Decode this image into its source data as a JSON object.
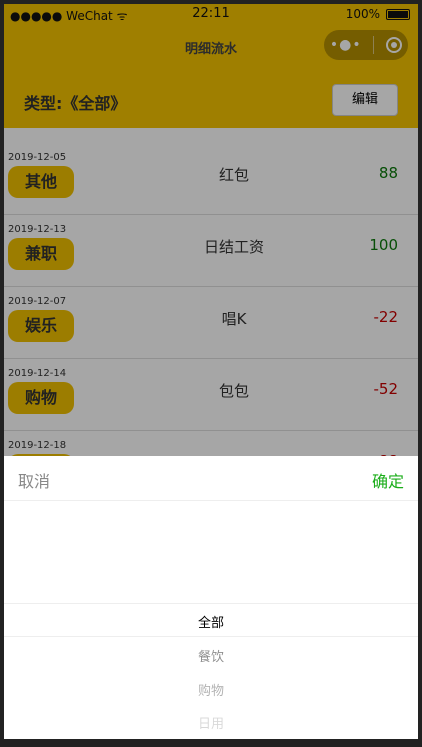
{
  "statusbar": {
    "carrier": "●●●●● WeChat",
    "wifi": "ᯤ",
    "time": "22:11",
    "battery": "100%"
  },
  "navbar": {
    "title": "明细流水",
    "more": "•●•"
  },
  "typebar": {
    "label": "类型:《全部》",
    "edit": "编辑"
  },
  "rows": [
    {
      "date": "2019-12-05",
      "tag": "其他",
      "name": "红包",
      "amount": "88",
      "sign": "pos"
    },
    {
      "date": "2019-12-13",
      "tag": "兼职",
      "name": "日结工资",
      "amount": "100",
      "sign": "pos"
    },
    {
      "date": "2019-12-07",
      "tag": "娱乐",
      "name": "唱K",
      "amount": "-22",
      "sign": "neg"
    },
    {
      "date": "2019-12-14",
      "tag": "购物",
      "name": "包包",
      "amount": "-52",
      "sign": "neg"
    },
    {
      "date": "2019-12-18",
      "tag": "",
      "name": "",
      "amount": "-88",
      "sign": "neg"
    }
  ],
  "sheet": {
    "cancel": "取消",
    "confirm": "确定"
  },
  "picker": {
    "options": [
      {
        "label": "全部",
        "opacity": 1.0
      },
      {
        "label": "餐饮",
        "opacity": 0.45
      },
      {
        "label": "购物",
        "opacity": 0.3
      },
      {
        "label": "日用",
        "opacity": 0.15
      }
    ]
  },
  "colors": {
    "primary": "#f4c300",
    "positive": "#0b7a0b",
    "negative": "#c80000",
    "confirm": "#1aad19"
  }
}
